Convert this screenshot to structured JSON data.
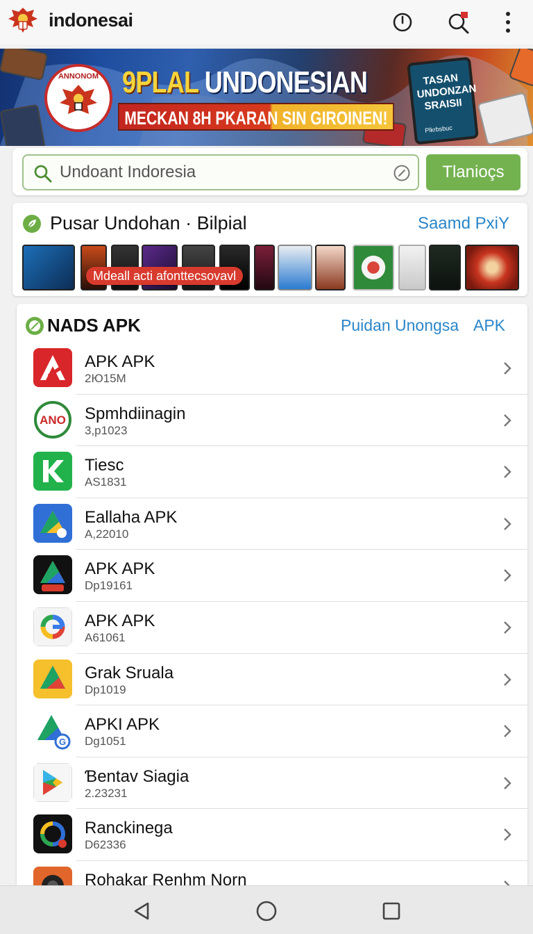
{
  "app_bar": {
    "title": "indonesai",
    "icons": [
      "garuda-logo-icon",
      "power-icon",
      "search-notification-icon",
      "more-vert-icon"
    ]
  },
  "banner": {
    "headline_1": "9PLAL",
    "headline_2": "UNDONESIAN",
    "subheadline": "MECKAN 8H PKARAN SIN GIROINEN!",
    "emblem_text": "ANNONOM",
    "tablet_text": "TASAN UNDONZAN SRAISII",
    "tablet_footer": "Plkrbsbuc"
  },
  "search": {
    "placeholder": "Undoant Indoresia",
    "button_label": "Tlanioçs"
  },
  "featured": {
    "title": "Pusar Undohan · Bilpial",
    "link": "Saamd PxiY",
    "caption": "Mdeall acti afonttecsovavl"
  },
  "list": {
    "title": "NADS APK",
    "link_1": "Puidan Unongsa",
    "link_2": "APK",
    "items": [
      {
        "name": "APK APK",
        "meta": "2Ю15M",
        "icon": "red-a-icon"
      },
      {
        "name": "Spmhdiinagin",
        "meta": "3,p1023",
        "icon": "ano-badge-icon"
      },
      {
        "name": "Tiesc",
        "meta": "AS1831",
        "icon": "green-k-icon"
      },
      {
        "name": "Eallaha APK",
        "meta": "A,22010",
        "icon": "blue-drive-icon"
      },
      {
        "name": "APK APK",
        "meta": "Dp19161",
        "icon": "dark-drive-icon"
      },
      {
        "name": "APK APK",
        "meta": "A61061",
        "icon": "google-g-icon"
      },
      {
        "name": "Grak Sruala",
        "meta": "Dp1019",
        "icon": "yellow-drive-icon"
      },
      {
        "name": "APKI APK",
        "meta": "Dg1051",
        "icon": "drive-g-icon"
      },
      {
        "name": "Ɓentav Siagia",
        "meta": "2.23231",
        "icon": "play-store-icon"
      },
      {
        "name": "Ranckinega",
        "meta": "D62336",
        "icon": "black-circle-app-icon"
      },
      {
        "name": "Rohakar Renhm Norn",
        "meta": "",
        "icon": "camera-app-icon"
      }
    ]
  },
  "nav": {
    "icons": [
      "back-triangle-icon",
      "home-circle-icon",
      "recents-square-icon"
    ]
  },
  "colors": {
    "accent_green": "#74b250",
    "link_blue": "#2a86c9",
    "banner_red": "#c2251f",
    "banner_yellow": "#f7d43a"
  }
}
